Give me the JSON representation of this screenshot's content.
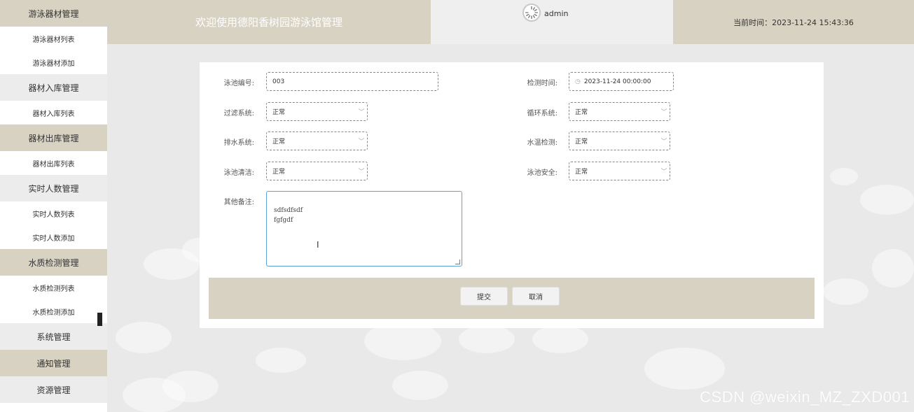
{
  "sidebar": {
    "items": [
      {
        "label": "游泳器材管理",
        "type": "group",
        "style": "tan"
      },
      {
        "label": "游泳器材列表",
        "type": "child"
      },
      {
        "label": "游泳器材添加",
        "type": "child"
      },
      {
        "label": "器材入库管理",
        "type": "group",
        "style": "plain"
      },
      {
        "label": "器材入库列表",
        "type": "child"
      },
      {
        "label": "器材出库管理",
        "type": "group",
        "style": "tan"
      },
      {
        "label": "器材出库列表",
        "type": "child"
      },
      {
        "label": "实时人数管理",
        "type": "group",
        "style": "plain"
      },
      {
        "label": "实时人数列表",
        "type": "child"
      },
      {
        "label": "实时人数添加",
        "type": "child"
      },
      {
        "label": "水质检测管理",
        "type": "group",
        "style": "tan"
      },
      {
        "label": "水质检测列表",
        "type": "child"
      },
      {
        "label": "水质检测添加",
        "type": "child"
      },
      {
        "label": "系统管理",
        "type": "group",
        "style": "plain"
      },
      {
        "label": "通知管理",
        "type": "group",
        "style": "tan"
      },
      {
        "label": "资源管理",
        "type": "group",
        "style": "plain"
      }
    ]
  },
  "header": {
    "title": "欢迎使用德阳香树园游泳馆管理",
    "user": "admin",
    "time": "当前时间：2023-11-24 15:43:36"
  },
  "form": {
    "pool_no_label": "泳池编号:",
    "pool_no_value": "003",
    "check_time_label": "检测时间:",
    "check_time_value": "2023-11-24 00:00:00",
    "filter_label": "过滤系统:",
    "filter_value": "正常",
    "circulation_label": "循环系统:",
    "circulation_value": "正常",
    "drain_label": "排水系统:",
    "drain_value": "正常",
    "water_temp_label": "水温检测:",
    "water_temp_value": "正常",
    "clean_label": "泳池清洁:",
    "clean_value": "正常",
    "safety_label": "泳池安全:",
    "safety_value": "正常",
    "remark_label": "其他备注:",
    "remark_value": "sdfsdfsdf\nfgfgdf"
  },
  "buttons": {
    "submit": "提交",
    "cancel": "取消"
  },
  "watermark": "CSDN @weixin_MZ_ZXD001",
  "colors": {
    "accent": "#d8d2c2",
    "background": "#e9e9e9",
    "focus_border": "#5aa3d6"
  }
}
